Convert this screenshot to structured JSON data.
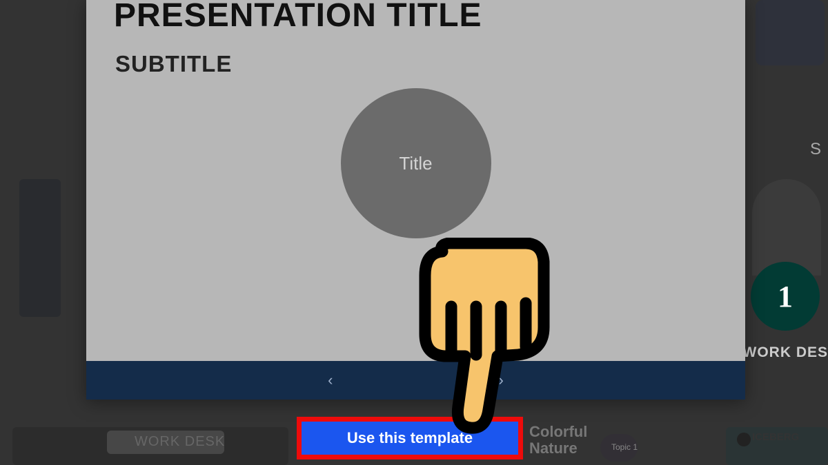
{
  "slide": {
    "title": "PRESENTATION TITLE",
    "subtitle": "SUBTITLE",
    "circle_label": "Title"
  },
  "modal_nav": {
    "prev": "‹",
    "next": "›"
  },
  "cta": {
    "use_template": "Use this template"
  },
  "background": {
    "badge_number": "1",
    "work_des_crop": "WORK DES",
    "s_crop": "S",
    "work_desk_label": "WORK DESK",
    "colorful_nature": "Colorful\nNature",
    "topic_label": "Topic 1",
    "iceberg_label": "ICEBERG"
  }
}
